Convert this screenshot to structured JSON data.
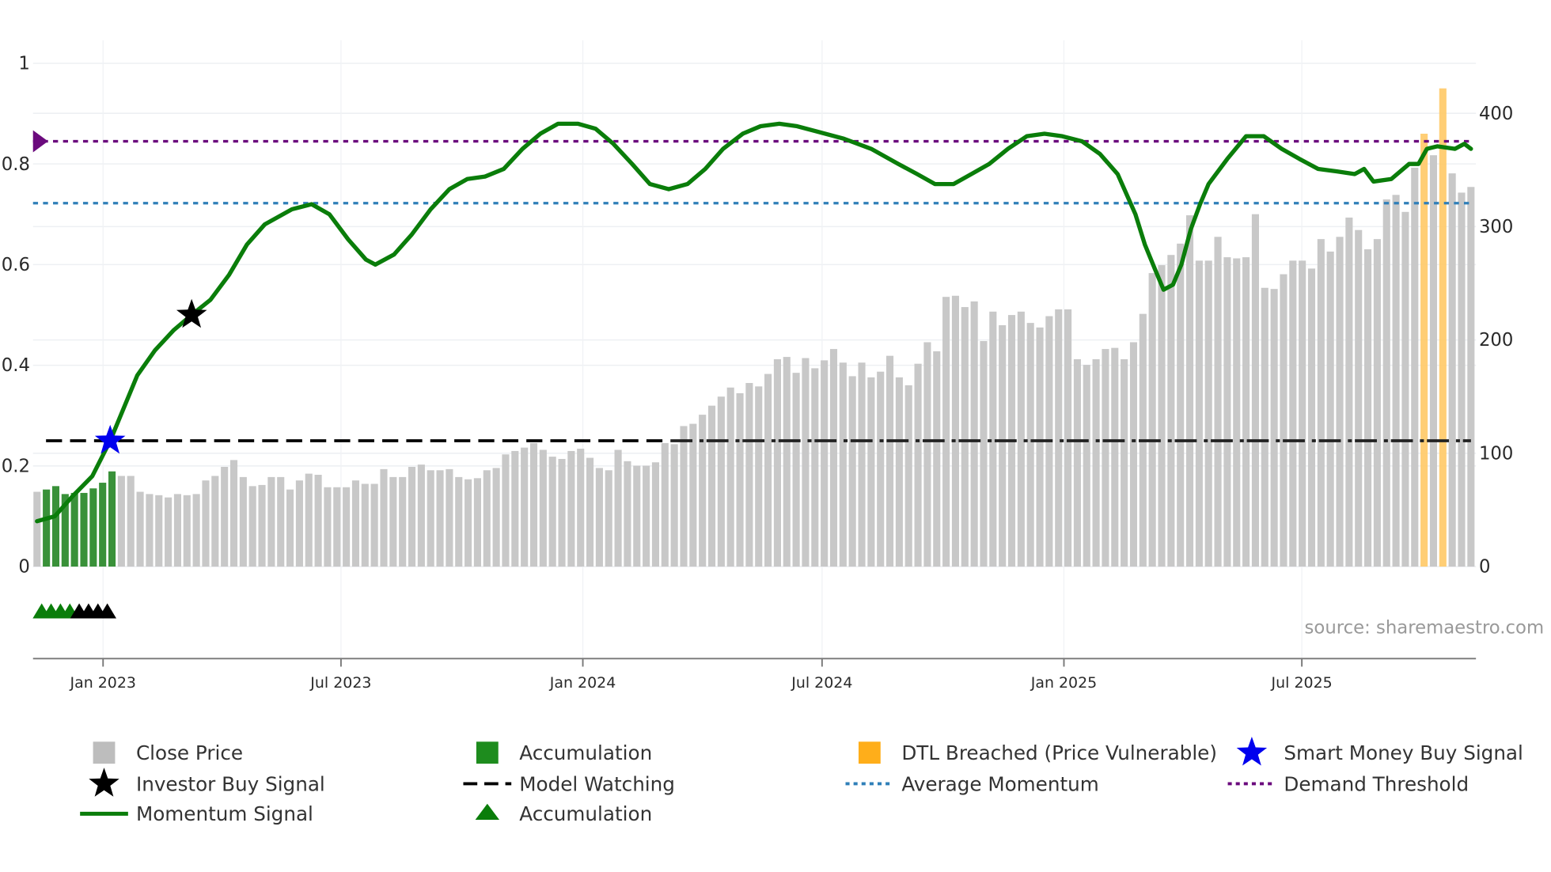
{
  "chart_data": {
    "type": "bar+line",
    "title": "",
    "source": "source: sharemaestro.com",
    "x_axis": {
      "type": "date",
      "ticks": [
        "Jan 2023",
        "Jul 2023",
        "Jan 2024",
        "Jul 2024",
        "Jan 2025",
        "Jul 2025"
      ],
      "tick_dates": [
        "2023-01-01",
        "2023-07-01",
        "2024-01-01",
        "2024-07-01",
        "2025-01-01",
        "2025-07-01"
      ],
      "bar_interval": "weekly"
    },
    "y_left": {
      "range": [
        -0.183,
        1.0
      ],
      "ticks": [
        0,
        0.2,
        0.4,
        0.6,
        0.8,
        1
      ],
      "tick_labels": [
        "0",
        "0.2",
        "0.4",
        "0.6",
        "0.8",
        "1"
      ]
    },
    "y_right": {
      "range": [
        0,
        444
      ],
      "ticks": [
        0,
        100,
        200,
        300,
        400
      ],
      "tick_labels": [
        "0",
        "100",
        "200",
        "300",
        "400"
      ]
    },
    "close_price": [
      66,
      68,
      71,
      64,
      65,
      65,
      69,
      74,
      84,
      80,
      80,
      66,
      64,
      63,
      61,
      64,
      63,
      64,
      76,
      80,
      88,
      94,
      79,
      71,
      72,
      79,
      79,
      68,
      76,
      82,
      81,
      70,
      70,
      70,
      76,
      73,
      73,
      86,
      79,
      79,
      88,
      90,
      85,
      85,
      86,
      79,
      77,
      78,
      85,
      87,
      99,
      102,
      105,
      109,
      103,
      97,
      95,
      102,
      104,
      96,
      87,
      85,
      103,
      93,
      89,
      89,
      92,
      109,
      108,
      124,
      126,
      134,
      142,
      150,
      158,
      153,
      162,
      159,
      170,
      183,
      185,
      171,
      184,
      175,
      182,
      192,
      180,
      168,
      180,
      167,
      172,
      186,
      167,
      160,
      179,
      198,
      190,
      238,
      239,
      229,
      234,
      199,
      225,
      213,
      222,
      225,
      215,
      211,
      221,
      227,
      227,
      183,
      178,
      183,
      192,
      193,
      183,
      198,
      223,
      259,
      266,
      275,
      285,
      310,
      270,
      270,
      291,
      273,
      272,
      273,
      311,
      246,
      245,
      258,
      270,
      270,
      263,
      289,
      278,
      291,
      308,
      297,
      280,
      289,
      324,
      328,
      313,
      352,
      382,
      363,
      422,
      347,
      330,
      335
    ],
    "accumulation_bar_indices": [
      1,
      2,
      3,
      4,
      5,
      6,
      7,
      8
    ],
    "dtl_breached_bar_indices": [
      148,
      150
    ],
    "momentum_signal": [
      [
        0,
        0.09
      ],
      [
        1.9,
        0.1
      ],
      [
        3.8,
        0.14
      ],
      [
        5.9,
        0.18
      ],
      [
        7.8,
        0.25
      ],
      [
        10.7,
        0.38
      ],
      [
        12.6,
        0.43
      ],
      [
        14.6,
        0.47
      ],
      [
        16.5,
        0.5
      ],
      [
        18.5,
        0.53
      ],
      [
        20.5,
        0.58
      ],
      [
        22.4,
        0.64
      ],
      [
        24.3,
        0.68
      ],
      [
        27.2,
        0.71
      ],
      [
        29.3,
        0.72
      ],
      [
        31.2,
        0.7
      ],
      [
        33.2,
        0.65
      ],
      [
        35.1,
        0.61
      ],
      [
        36.1,
        0.6
      ],
      [
        38.1,
        0.62
      ],
      [
        40,
        0.66
      ],
      [
        42,
        0.71
      ],
      [
        44,
        0.75
      ],
      [
        45.9,
        0.77
      ],
      [
        47.8,
        0.775
      ],
      [
        49.8,
        0.79
      ],
      [
        51.8,
        0.83
      ],
      [
        53.7,
        0.86
      ],
      [
        55.6,
        0.88
      ],
      [
        57.7,
        0.88
      ],
      [
        59.6,
        0.87
      ],
      [
        61.5,
        0.84
      ],
      [
        63.5,
        0.8
      ],
      [
        65.4,
        0.76
      ],
      [
        67.4,
        0.75
      ],
      [
        69.4,
        0.76
      ],
      [
        71.3,
        0.79
      ],
      [
        73.2,
        0.83
      ],
      [
        75.3,
        0.86
      ],
      [
        77.2,
        0.875
      ],
      [
        79.2,
        0.88
      ],
      [
        81.1,
        0.875
      ],
      [
        83.1,
        0.865
      ],
      [
        86.1,
        0.85
      ],
      [
        89,
        0.83
      ],
      [
        91.9,
        0.8
      ],
      [
        93.9,
        0.78
      ],
      [
        95.8,
        0.76
      ],
      [
        97.8,
        0.76
      ],
      [
        99.7,
        0.78
      ],
      [
        101.6,
        0.8
      ],
      [
        103.6,
        0.83
      ],
      [
        105.6,
        0.855
      ],
      [
        107.5,
        0.86
      ],
      [
        109.4,
        0.855
      ],
      [
        111.5,
        0.845
      ],
      [
        113.4,
        0.82
      ],
      [
        115.3,
        0.78
      ],
      [
        117.2,
        0.7
      ],
      [
        118.2,
        0.64
      ],
      [
        119.3,
        0.59
      ],
      [
        120.2,
        0.55
      ],
      [
        121.2,
        0.56
      ],
      [
        122.1,
        0.6
      ],
      [
        123.1,
        0.67
      ],
      [
        124.1,
        0.72
      ],
      [
        125,
        0.76
      ],
      [
        127,
        0.81
      ],
      [
        129,
        0.855
      ],
      [
        130.9,
        0.855
      ],
      [
        132.8,
        0.83
      ],
      [
        134.7,
        0.81
      ],
      [
        136.7,
        0.79
      ],
      [
        138.7,
        0.785
      ],
      [
        140.6,
        0.78
      ],
      [
        141.6,
        0.79
      ],
      [
        142.6,
        0.765
      ],
      [
        144.5,
        0.77
      ],
      [
        146.4,
        0.8
      ],
      [
        147.4,
        0.8
      ],
      [
        148.3,
        0.83
      ],
      [
        149.4,
        0.835
      ],
      [
        151.3,
        0.83
      ],
      [
        152.3,
        0.84
      ],
      [
        153,
        0.83
      ]
    ],
    "model_watching": 0.25,
    "average_momentum": 0.722,
    "demand_threshold": 0.845,
    "smart_money_buy_signal": [
      [
        7.8,
        0.25
      ]
    ],
    "investor_buy_signal": [
      [
        16.5,
        0.5
      ]
    ],
    "accumulation_markers": [
      0.5,
      1.5,
      2.5,
      3.5
    ],
    "model_watching_markers": [
      4.5,
      5.5,
      6.5,
      7.5
    ],
    "marker_level": -0.088,
    "colors": {
      "close": "#c8c8c8",
      "accumulation": "#2e8b2e",
      "dtl": "#ffc966",
      "momentum": "#0a7d0a",
      "avg": "#2f7fb8",
      "demand": "#6b0a7d",
      "watching": "#000000",
      "smart": "#0000ee",
      "investor": "#000000"
    },
    "legend": [
      {
        "label": "Close Price",
        "symbol": "square",
        "color": "#bdbdbd"
      },
      {
        "label": "Accumulation",
        "symbol": "square",
        "color": "#1e8c1e"
      },
      {
        "label": "DTL Breached (Price Vulnerable)",
        "symbol": "square",
        "color": "#ffae1a"
      },
      {
        "label": "Smart Money Buy Signal",
        "symbol": "star",
        "color": "#0000ee"
      },
      {
        "label": "Investor Buy Signal",
        "symbol": "star",
        "color": "#000000"
      },
      {
        "label": "Model Watching",
        "symbol": "dash",
        "color": "#000000"
      },
      {
        "label": "Average Momentum",
        "symbol": "dot",
        "color": "#2f7fb8"
      },
      {
        "label": "Demand Threshold",
        "symbol": "dot",
        "color": "#6b0a7d"
      },
      {
        "label": "Momentum Signal",
        "symbol": "line",
        "color": "#0a7d0a"
      },
      {
        "label": "Accumulation",
        "symbol": "triangle",
        "color": "#0a7d0a"
      }
    ]
  }
}
